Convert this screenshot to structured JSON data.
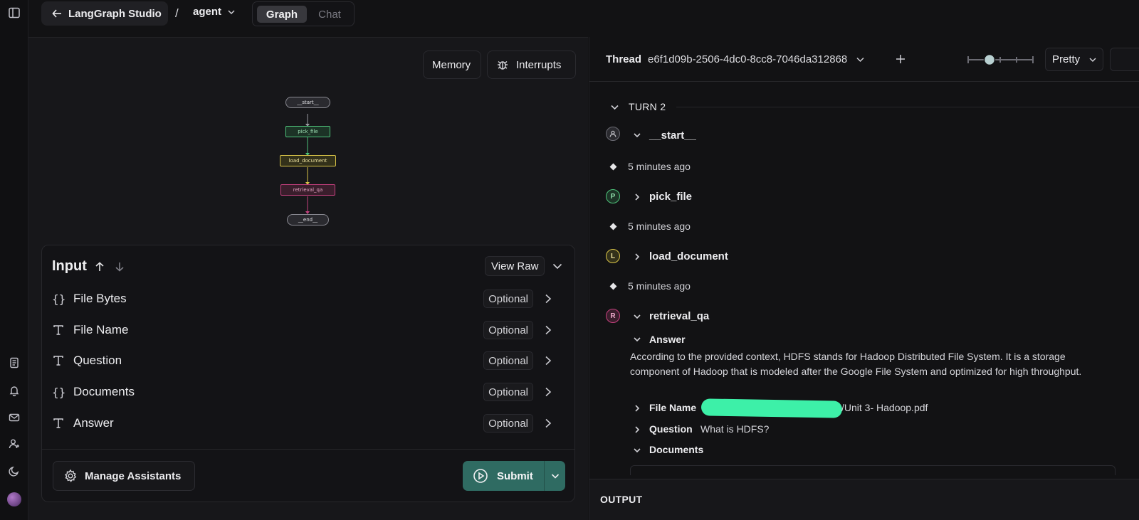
{
  "app": {
    "back_label": "LangGraph Studio",
    "separator": "/",
    "graph_name": "agent",
    "tabs": [
      {
        "label": "Graph",
        "active": true
      },
      {
        "label": "Chat",
        "active": false
      }
    ]
  },
  "graph_toolbar": {
    "memory_label": "Memory",
    "interrupts_label": "Interrupts"
  },
  "graph": {
    "nodes": [
      "__start__",
      "pick_file",
      "load_document",
      "retrieval_qa",
      "__end__"
    ]
  },
  "input_panel": {
    "title": "Input",
    "view_raw_label": "View Raw",
    "fields": [
      {
        "icon": "braces-icon",
        "label": "File Bytes",
        "badge": "Optional"
      },
      {
        "icon": "text-type-icon",
        "label": "File Name",
        "badge": "Optional"
      },
      {
        "icon": "text-type-icon",
        "label": "Question",
        "badge": "Optional"
      },
      {
        "icon": "braces-icon",
        "label": "Documents",
        "badge": "Optional"
      },
      {
        "icon": "text-type-icon",
        "label": "Answer",
        "badge": "Optional"
      }
    ],
    "manage_assistants_label": "Manage Assistants",
    "submit_label": "Submit"
  },
  "thread": {
    "label": "Thread",
    "id": "e6f1d09b-2506-4dc0-8cc8-7046da312868",
    "view_mode": "Pretty",
    "turn_label": "TURN 2",
    "steps": [
      {
        "avatar": "",
        "name": "__start__",
        "time": "5 minutes ago"
      },
      {
        "avatar": "P",
        "name": "pick_file",
        "time": "5 minutes ago"
      },
      {
        "avatar": "L",
        "name": "load_document",
        "time": "5 minutes ago"
      },
      {
        "avatar": "R",
        "name": "retrieval_qa"
      }
    ],
    "answer_label": "Answer",
    "answer_text": "According to the provided context, HDFS stands for Hadoop Distributed File System. It is a storage component of Hadoop that is modeled after the Google File System and optimized for high throughput.",
    "file_name_label": "File Name",
    "file_name_value": "/Unit 3- Hadoop.pdf",
    "question_label": "Question",
    "question_value": "What is HDFS?",
    "documents_label": "Documents",
    "output_label": "OUTPUT"
  },
  "colors": {
    "accent_green": "#2f6b62",
    "redaction": "#3df0a8",
    "pick_file": "#4ec27a",
    "load_document": "#d8c348",
    "retrieval_qa": "#c4407e"
  }
}
